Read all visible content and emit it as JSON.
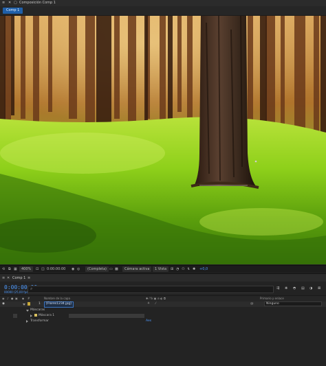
{
  "header": {
    "title": "Composición Comp 1",
    "menu_icon": "hamburger-icon",
    "close_icon": "close-icon",
    "lock_icon": "lock-icon"
  },
  "comp_tab": {
    "label": "Comp 1"
  },
  "viewer": {
    "image_description": "forest-scene"
  },
  "viewer_toolbar": {
    "zoom": "400%",
    "timecode": "0:00:00:00",
    "resolution": "(Completa)",
    "camera": "Cámara activa",
    "views": "1 Vista",
    "exposure": "+0,0"
  },
  "timeline": {
    "tab_label": "Comp 1",
    "timecode": "0:00:00:00",
    "frame_info": "00000 (25,00 fps)",
    "search_placeholder": "",
    "columns": {
      "layer_name": "Nombre de la capa",
      "parent": "Primario y enlace",
      "switches": "✱ ⁄ fx ▣ ⊘ ◐ ⧉"
    },
    "layers": [
      {
        "number": "1",
        "name": "[Flores1234.jpg]",
        "parent": "Ninguno"
      }
    ],
    "mask_group": "Máscaras",
    "mask_1": "Máscara 1",
    "transform": "Transformar",
    "mask_mode": "Aes"
  },
  "colors": {
    "accent": "#4f9bff",
    "tab_blue": "#1f5fa8",
    "panel": "#232323"
  }
}
